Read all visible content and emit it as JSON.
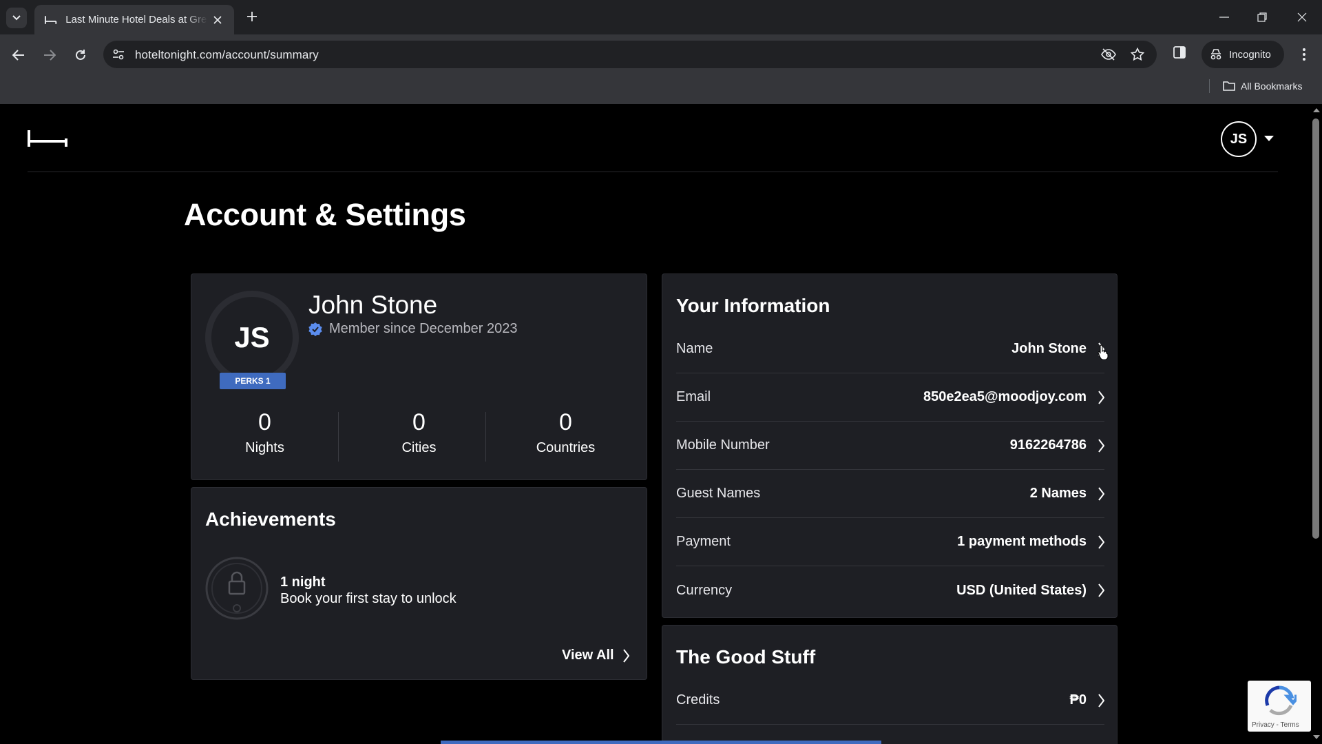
{
  "browser": {
    "tab_title": "Last Minute Hotel Deals at Great Prices",
    "url": "hoteltonight.com/account/summary",
    "incognito_label": "Incognito",
    "bookmarks_label": "All Bookmarks"
  },
  "header": {
    "avatar_initials": "JS"
  },
  "page": {
    "title": "Account & Settings"
  },
  "profile": {
    "initials": "JS",
    "perks_badge": "PERKS 1",
    "name": "John Stone",
    "member_since": "Member since December 2023",
    "stats": [
      {
        "value": "0",
        "label": "Nights"
      },
      {
        "value": "0",
        "label": "Cities"
      },
      {
        "value": "0",
        "label": "Countries"
      }
    ]
  },
  "achievements": {
    "heading": "Achievements",
    "item_title": "1 night",
    "item_desc": "Book your first stay to unlock",
    "view_all": "View All"
  },
  "your_information": {
    "heading": "Your Information",
    "rows": [
      {
        "label": "Name",
        "value": "John Stone"
      },
      {
        "label": "Email",
        "value": "850e2ea5@moodjoy.com"
      },
      {
        "label": "Mobile Number",
        "value": "9162264786"
      },
      {
        "label": "Guest Names",
        "value": "2 Names"
      },
      {
        "label": "Payment",
        "value": "1 payment methods"
      },
      {
        "label": "Currency",
        "value": "USD (United States)"
      }
    ]
  },
  "good_stuff": {
    "heading": "The Good Stuff",
    "rows": [
      {
        "label": "Credits",
        "value": "₱0"
      }
    ]
  },
  "recaptcha": {
    "links": "Privacy - Terms"
  },
  "colors": {
    "page_bg": "#000000",
    "card_bg": "#1e1f24",
    "accent_blue": "#3f6bbf",
    "verified_blue": "#5b8def"
  }
}
